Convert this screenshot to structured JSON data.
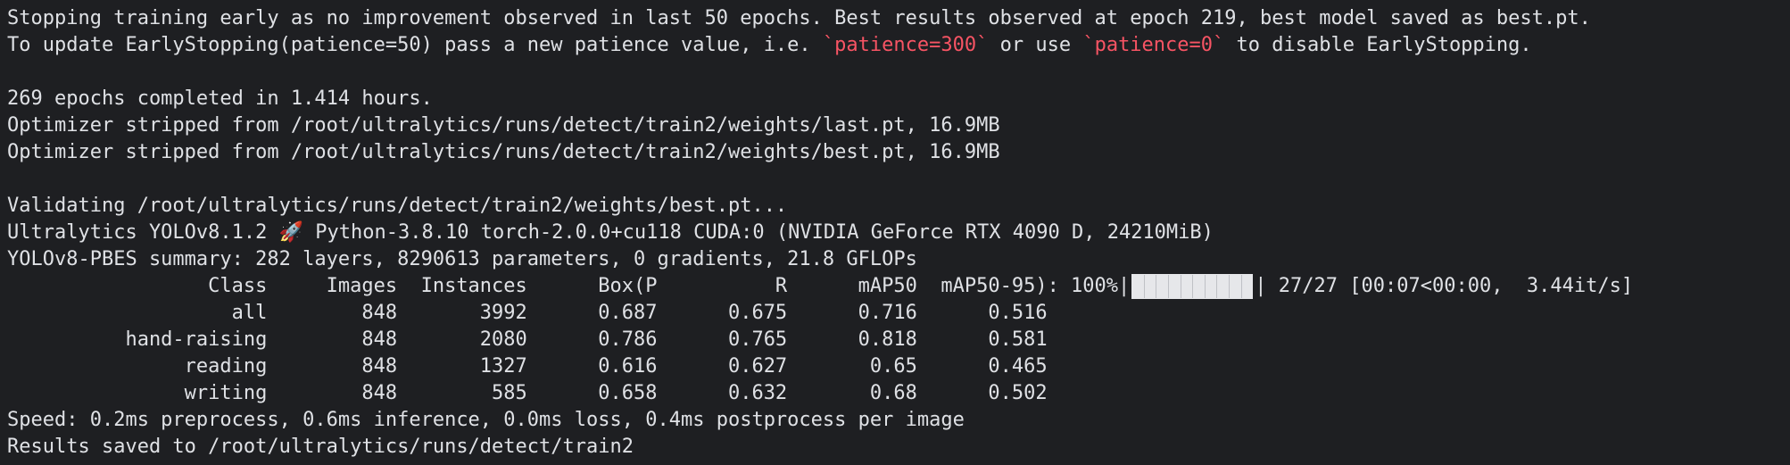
{
  "terminal": {
    "colors": {
      "background": "#1e1f22",
      "foreground": "#dfe1e5",
      "highlight": "#f75464"
    },
    "line1": "Stopping training early as no improvement observed in last 50 epochs. Best results observed at epoch 219, best model saved as best.pt.",
    "line2": {
      "a": "To update EarlyStopping(patience=50) pass a new patience value, i.e. ",
      "b": "`patience=300`",
      "c": " or use ",
      "d": "`patience=0`",
      "e": " to disable EarlyStopping."
    },
    "line3": "269 epochs completed in 1.414 hours.",
    "line4": "Optimizer stripped from /root/ultralytics/runs/detect/train2/weights/last.pt, 16.9MB",
    "line5": "Optimizer stripped from /root/ultralytics/runs/detect/train2/weights/best.pt, 16.9MB",
    "line6": "Validating /root/ultralytics/runs/detect/train2/weights/best.pt...",
    "line7": "Ultralytics YOLOv8.1.2 🚀 Python-3.8.10 torch-2.0.0+cu118 CUDA:0 (NVIDIA GeForce RTX 4090 D, 24210MiB)",
    "line8": "YOLOv8-PBES summary: 282 layers, 8290613 parameters, 0 gradients, 21.8 GFLOPs",
    "header_line": "                 Class     Images  Instances      Box(P          R      mAP50  mAP50-95): 100%|",
    "progress": {
      "fraction": 1.0,
      "tail": "| 27/27 [00:07<00:00,  3.44it/s]"
    },
    "rows": [
      "                   all        848       3992      0.687      0.675      0.716      0.516",
      "          hand-raising        848       2080      0.786      0.765      0.818      0.581",
      "               reading        848       1327      0.616      0.627       0.65      0.465",
      "               writing        848        585      0.658      0.632       0.68      0.502"
    ],
    "speed": "Speed: 0.2ms preprocess, 0.6ms inference, 0.0ms loss, 0.4ms postprocess per image",
    "results": "Results saved to /root/ultralytics/runs/detect/train2"
  }
}
